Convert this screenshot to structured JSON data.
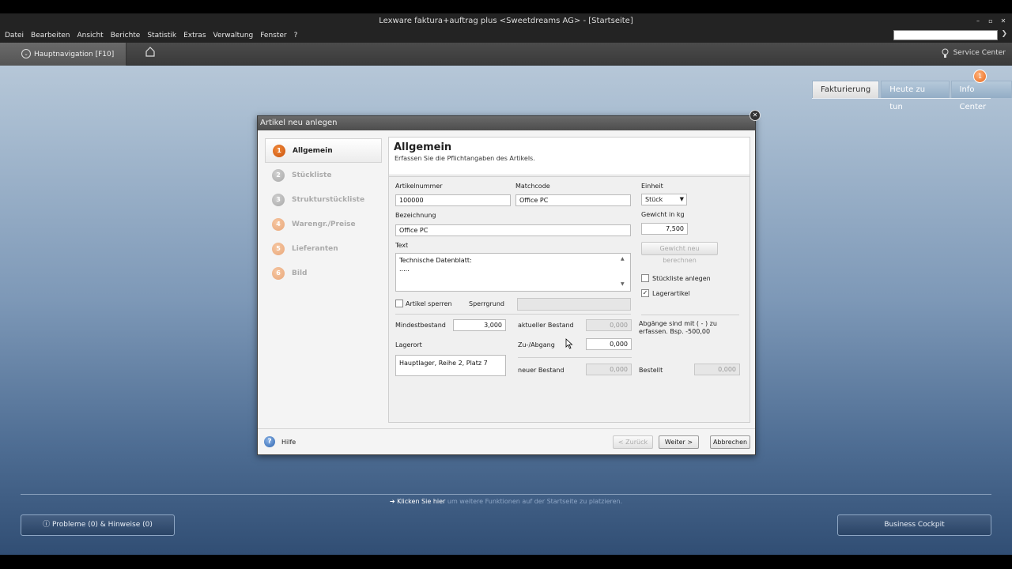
{
  "window": {
    "title": "Lexware faktura+auftrag plus <Sweetdreams AG> - [Startseite]",
    "controls": [
      "–",
      "▫",
      "✕"
    ]
  },
  "menu": [
    "Datei",
    "Bearbeiten",
    "Ansicht",
    "Berichte",
    "Statistik",
    "Extras",
    "Verwaltung",
    "Fenster",
    "?"
  ],
  "nav": {
    "hauptnavigation": "Hauptnavigation [F10]",
    "service_center": "Service Center"
  },
  "tabs": [
    {
      "label": "Fakturierung",
      "active": true
    },
    {
      "label": "Heute zu tun",
      "active": false
    },
    {
      "label": "Info Center",
      "active": false
    }
  ],
  "badge_count": "1",
  "dialog": {
    "title": "Artikel neu anlegen",
    "steps": [
      {
        "num": "1",
        "label": "Allgemein"
      },
      {
        "num": "2",
        "label": "Stückliste"
      },
      {
        "num": "3",
        "label": "Strukturstückliste"
      },
      {
        "num": "4",
        "label": "Warengr./Preise"
      },
      {
        "num": "5",
        "label": "Lieferanten"
      },
      {
        "num": "6",
        "label": "Bild"
      }
    ],
    "header": {
      "title": "Allgemein",
      "subtitle": "Erfassen Sie die Pflichtangaben des Artikels."
    },
    "form": {
      "artikelnummer_label": "Artikelnummer",
      "artikelnummer_value": "100000",
      "matchcode_label": "Matchcode",
      "matchcode_value": "Office PC",
      "einheit_label": "Einheit",
      "einheit_value": "Stück",
      "bezeichnung_label": "Bezeichnung",
      "bezeichnung_value": "Office PC",
      "gewicht_label": "Gewicht in kg",
      "gewicht_value": "7,500",
      "gewicht_button": "Gewicht neu berechnen",
      "text_label": "Text",
      "text_value": "Technische Datenblatt:\n.....",
      "stueckliste_label": "Stückliste anlegen",
      "lagerartikel_label": "Lagerartikel",
      "artikel_sperren_label": "Artikel sperren",
      "sperrgrund_label": "Sperrgrund",
      "sperrgrund_value": "",
      "mindestbestand_label": "Mindestbestand",
      "mindestbestand_value": "3,000",
      "aktueller_bestand_label": "aktueller Bestand",
      "aktueller_bestand_value": "0,000",
      "hinweis": "Abgänge sind mit ( - ) zu erfassen. Bsp. -500,00",
      "lagerort_label": "Lagerort",
      "lagerort_value": "Hauptlager, Reihe 2, Platz 7",
      "zu_abgang_label": "Zu-/Abgang",
      "zu_abgang_value": "0,000",
      "neuer_bestand_label": "neuer Bestand",
      "neuer_bestand_value": "0,000",
      "bestellt_label": "Bestellt",
      "bestellt_value": "0,000"
    },
    "footer": {
      "help": "Hilfe",
      "back": "< Zurück",
      "next": "Weiter >",
      "cancel": "Abbrechen"
    }
  },
  "hint": {
    "link": "Klicken Sie hier",
    "rest": " um weitere Funktionen auf der Startseite zu platzieren."
  },
  "bottom": {
    "problems": "Probleme (0) & Hinweise (0)",
    "cockpit": "Business Cockpit"
  }
}
